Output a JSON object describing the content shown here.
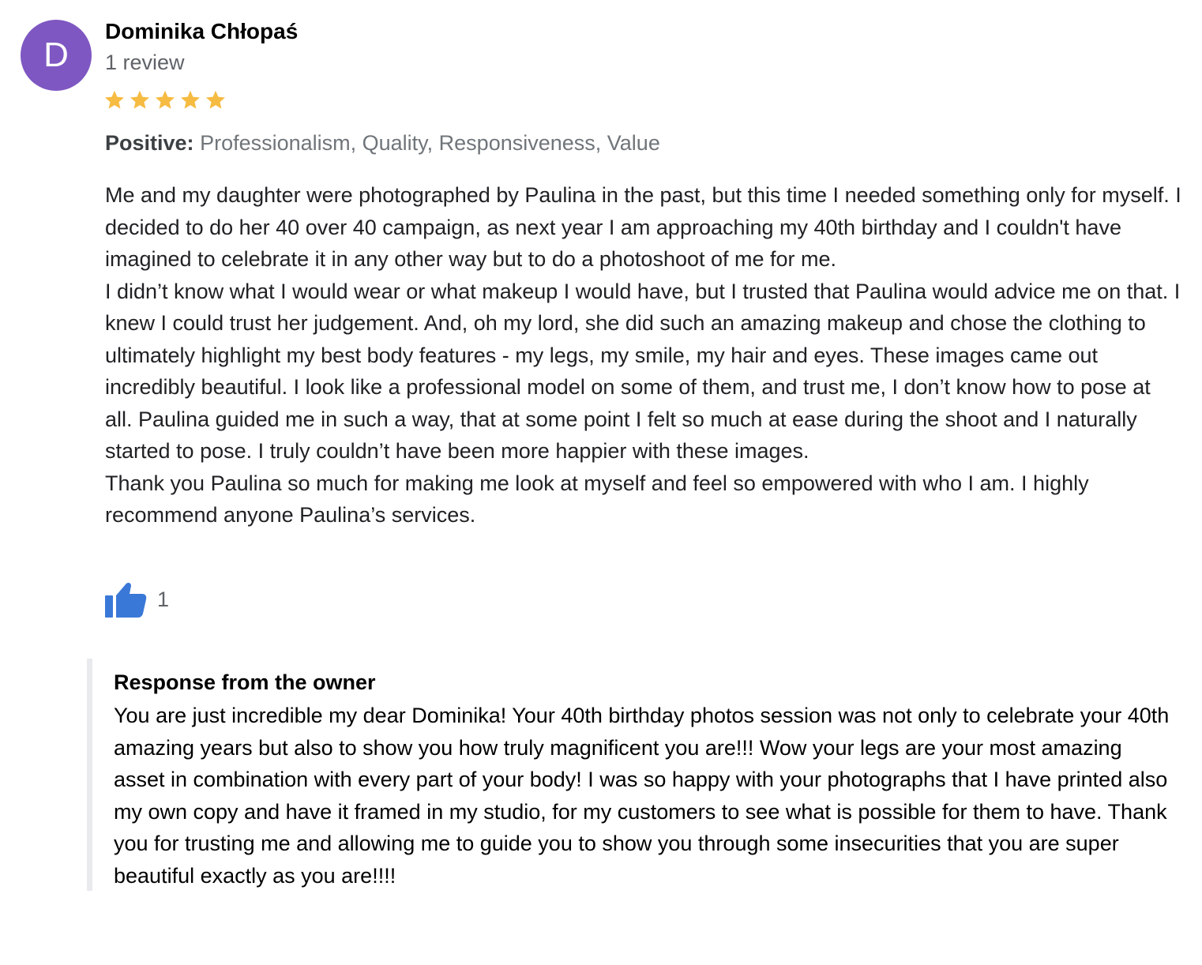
{
  "colors": {
    "avatar_bg": "#7e57c2",
    "star": "#f6bb42",
    "like": "#3a78d8"
  },
  "reviewer": {
    "avatar_letter": "D",
    "name": "Dominika Chłopaś",
    "review_count": "1 review"
  },
  "rating": {
    "value": 5,
    "max": 5,
    "icon": "star-icon"
  },
  "positive": {
    "label": "Positive:",
    "items": "Professionalism, Quality, Responsiveness, Value"
  },
  "review": {
    "paragraphs": [
      "Me and my daughter were photographed by Paulina in the past, but this time I needed something only for myself. I decided to do her 40 over 40 campaign, as next year I am approaching my 40th birthday and I couldn't have imagined to celebrate it in any other way but to do a photoshoot of me for me.",
      "I didn’t know what I would wear  or what makeup I would have, but I trusted that Paulina would advice me on that. I knew I could trust her judgement. And, oh my lord, she did such an amazing makeup and chose the clothing to ultimately highlight my best body features - my legs, my smile, my hair and eyes. These images came out incredibly beautiful. I look like a professional model on some of them, and trust me, I don’t know how to pose at all. Paulina guided me in such a way, that at some point I felt so much at ease during the shoot and I naturally started to pose. I truly couldn’t have been more happier with these images.",
      "Thank you Paulina so much for making me look at myself and feel so empowered with who I am. I highly recommend anyone Paulina’s services."
    ]
  },
  "likes": {
    "icon": "thumbs-up-icon",
    "count": "1"
  },
  "owner_response": {
    "title": "Response from the owner",
    "text": "You are just incredible my dear Dominika! Your 40th birthday photos session was not only to celebrate your 40th amazing years but also to show you how truly magnificent you are!!! Wow your legs are your most amazing asset in combination with every part of your body! I was so happy with your photographs that I have printed also my own copy and have it framed in my studio, for my customers to see what is possible for them to have. Thank you for trusting me and allowing me to guide you to show you through some insecurities that you are super beautiful exactly as you are!!!!"
  }
}
